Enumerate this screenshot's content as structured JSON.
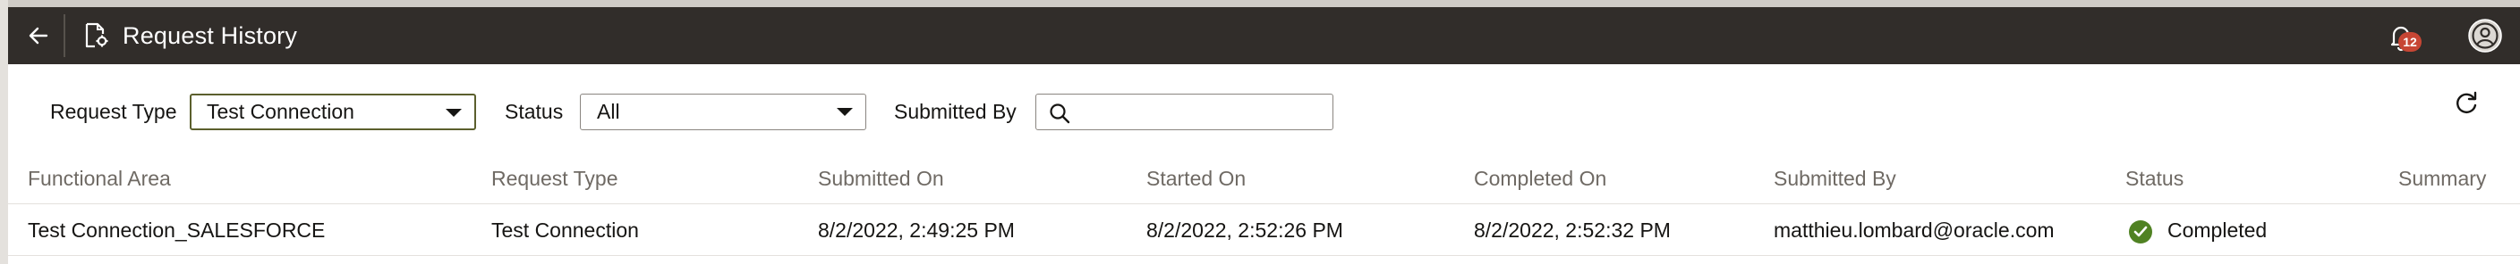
{
  "header": {
    "title": "Request History",
    "notification_count": "12"
  },
  "filters": {
    "request_type_label": "Request Type",
    "request_type_value": "Test Connection",
    "status_label": "Status",
    "status_value": "All",
    "submitted_by_label": "Submitted By",
    "submitted_by_value": "",
    "submitted_by_placeholder": ""
  },
  "table": {
    "columns": [
      "Functional Area",
      "Request Type",
      "Submitted On",
      "Started On",
      "Completed On",
      "Submitted By",
      "Status",
      "Summary"
    ],
    "rows": [
      {
        "functional_area": "Test Connection_SALESFORCE",
        "request_type": "Test Connection",
        "submitted_on": "8/2/2022, 2:49:25 PM",
        "started_on": "8/2/2022, 2:52:26 PM",
        "completed_on": "8/2/2022, 2:52:32 PM",
        "submitted_by": "matthieu.lombard@oracle.com",
        "status": "Completed",
        "summary": ""
      }
    ]
  },
  "icons": {
    "back": "arrow-left-icon",
    "page": "document-gear-icon",
    "notifications": "bell-icon",
    "user": "user-avatar-icon",
    "search": "search-icon",
    "refresh": "refresh-icon",
    "status": "check-circle-icon",
    "dropdown": "caret-down-icon"
  },
  "colors": {
    "header_bg": "#312d2a",
    "badge": "#c74634",
    "success": "#508223",
    "active_border": "#5b5f2d"
  }
}
